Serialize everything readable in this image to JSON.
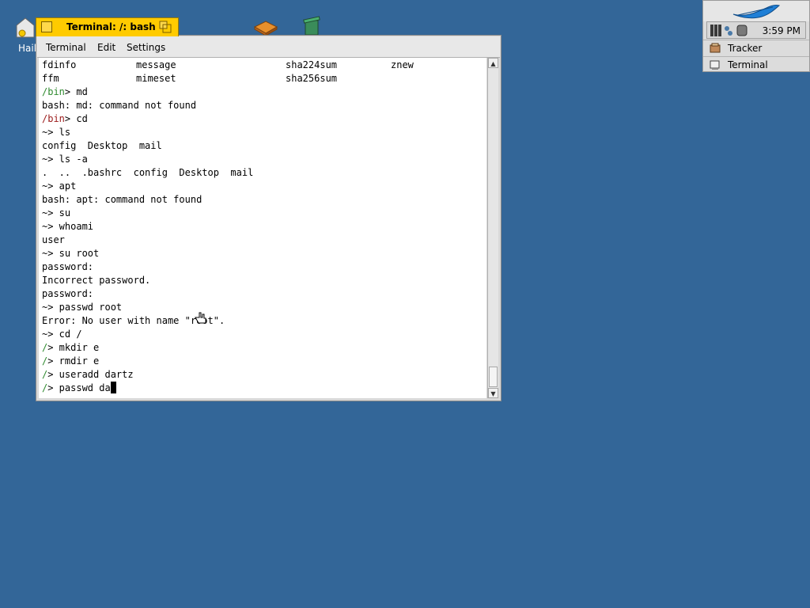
{
  "desktop": {
    "icon_home_label": "Haik",
    "icons": [
      "home-icon",
      "package-icon",
      "trash-icon"
    ]
  },
  "window": {
    "title": "Terminal: /: bash",
    "menu": [
      "Terminal",
      "Edit",
      "Settings"
    ]
  },
  "terminal": {
    "row1": [
      "fdinfo",
      "message",
      "sha224sum",
      "znew"
    ],
    "row2": [
      "ffm",
      "mimeset",
      "sha256sum"
    ],
    "lines": [
      {
        "prompt": "/bin",
        "prompt_color": "green",
        "text": "> md"
      },
      {
        "text": "bash: md: command not found"
      },
      {
        "prompt": "/bin",
        "prompt_color": "red",
        "text": "> cd"
      },
      {
        "text": "~> ls"
      },
      {
        "text": "config  Desktop  mail"
      },
      {
        "text": "~> ls -a"
      },
      {
        "text": ".  ..  .bashrc  config  Desktop  mail"
      },
      {
        "text": "~> apt"
      },
      {
        "text": "bash: apt: command not found"
      },
      {
        "text": "~> su"
      },
      {
        "text": "~> whoami"
      },
      {
        "text": "user"
      },
      {
        "text": "~> su root"
      },
      {
        "text": "password:"
      },
      {
        "text": "Incorrect password."
      },
      {
        "text": "password:"
      },
      {
        "text": "~> passwd root"
      },
      {
        "text": "Error: No user with name \"root\"."
      },
      {
        "text": "~> cd /"
      },
      {
        "prompt": "/",
        "prompt_color": "green",
        "text": "> mkdir e"
      },
      {
        "prompt": "/",
        "prompt_color": "green",
        "text": "> rmdir e"
      },
      {
        "prompt": "/",
        "prompt_color": "green",
        "text": "> useradd dartz"
      },
      {
        "prompt": "/",
        "prompt_color": "green",
        "text": "> passwd da"
      }
    ]
  },
  "deskbar": {
    "clock": "3:59 PM",
    "apps": [
      "Tracker",
      "Terminal"
    ]
  },
  "colors": {
    "desktop": "#336698",
    "tab": "#ffcb00",
    "prompt_green": "#2f8a2f",
    "prompt_red": "#9b1a1a"
  }
}
